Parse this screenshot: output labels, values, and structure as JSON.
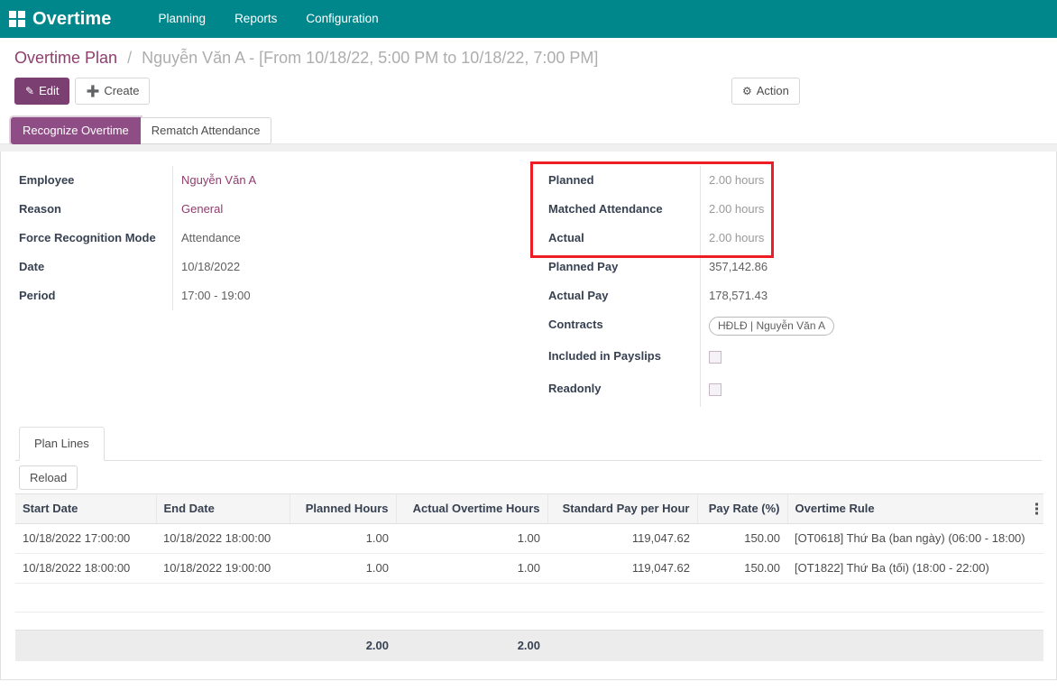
{
  "navbar": {
    "apps_icon": "apps-grid-icon",
    "brand": "Overtime",
    "menu": [
      {
        "label": "Planning"
      },
      {
        "label": "Reports"
      },
      {
        "label": "Configuration"
      }
    ],
    "bg_color": "#00878c"
  },
  "breadcrumb": {
    "root": "Overtime Plan",
    "separator": "/",
    "current": "Nguyễn Văn A - [From 10/18/22, 5:00 PM to 10/18/22, 7:00 PM]"
  },
  "control_panel": {
    "edit_label": "Edit",
    "edit_icon": "pencil-icon",
    "create_label": "Create",
    "create_icon": "plus-icon",
    "action_label": "Action",
    "action_icon": "gear-icon",
    "primary_color": "#7c3f72"
  },
  "statusbar": {
    "buttons": [
      {
        "label": "Recognize Overtime",
        "active": true
      },
      {
        "label": "Rematch Attendance",
        "active": false
      }
    ],
    "active_color": "#8f4d85"
  },
  "form": {
    "left_fields": [
      {
        "label": "Employee",
        "value": "Nguyễn Văn A",
        "style": "link"
      },
      {
        "label": "Reason",
        "value": "General",
        "style": "link"
      },
      {
        "label": "Force Recognition Mode",
        "value": "Attendance",
        "style": "text"
      },
      {
        "label": "Date",
        "value": "10/18/2022",
        "style": "text"
      },
      {
        "label": "Period",
        "value": "17:00 - 19:00",
        "style": "text"
      }
    ],
    "hours_fields": [
      {
        "label": "Planned",
        "value": "2.00 hours"
      },
      {
        "label": "Matched Attendance",
        "value": "2.00 hours"
      },
      {
        "label": "Actual",
        "value": "2.00 hours"
      }
    ],
    "highlight_color": "#ee1c25",
    "right_fields": [
      {
        "label": "Planned Pay",
        "value": "357,142.86"
      },
      {
        "label": "Actual Pay",
        "value": "178,571.43"
      }
    ],
    "contracts_label": "Contracts",
    "contracts_tag": "HĐLĐ | Nguyễn Văn A",
    "included_in_payslips_label": "Included in Payslips",
    "readonly_label": "Readonly"
  },
  "notebook": {
    "tabs": [
      {
        "label": "Plan Lines",
        "active": true
      }
    ],
    "reload_label": "Reload"
  },
  "table": {
    "columns": [
      "Start Date",
      "End Date",
      "Planned Hours",
      "Actual Overtime Hours",
      "Standard Pay per Hour",
      "Pay Rate (%)",
      "Overtime Rule"
    ],
    "rows": [
      {
        "start_date": "10/18/2022 17:00:00",
        "end_date": "10/18/2022 18:00:00",
        "planned_hours": "1.00",
        "actual_overtime_hours": "1.00",
        "standard_pay_per_hour": "119,047.62",
        "pay_rate": "150.00",
        "overtime_rule": "[OT0618] Thứ Ba (ban ngày) (06:00 - 18:00)"
      },
      {
        "start_date": "10/18/2022 18:00:00",
        "end_date": "10/18/2022 19:00:00",
        "planned_hours": "1.00",
        "actual_overtime_hours": "1.00",
        "standard_pay_per_hour": "119,047.62",
        "pay_rate": "150.00",
        "overtime_rule": "[OT1822] Thứ Ba (tối) (18:00 - 22:00)"
      }
    ],
    "totals": {
      "planned_hours": "2.00",
      "actual_overtime_hours": "2.00"
    },
    "options_icon": "kebab-menu-icon"
  }
}
